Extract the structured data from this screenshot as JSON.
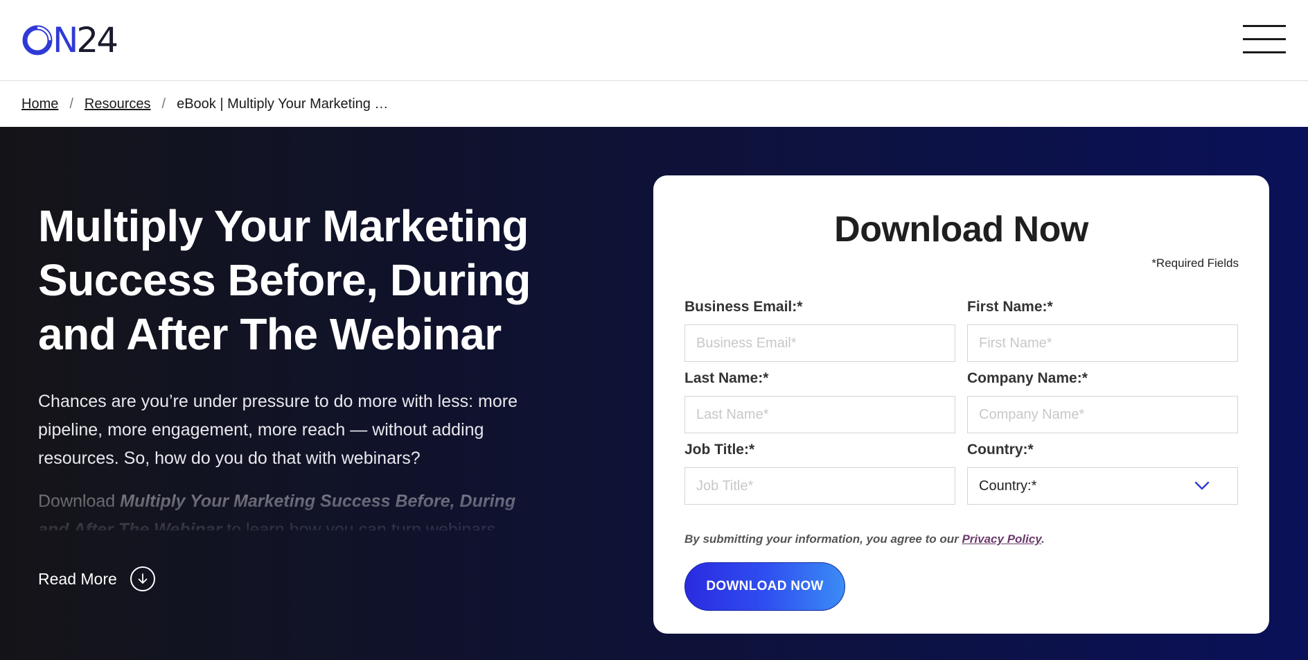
{
  "header": {
    "logo_prefix": "O",
    "logo_n": "N",
    "logo_digits": "24",
    "brand_color": "#2f3ad6"
  },
  "breadcrumb": {
    "items": [
      "Home",
      "Resources"
    ],
    "separator": "/",
    "current": "eBook | Multiply Your Marketing …"
  },
  "hero": {
    "title": "Multiply Your Marketing Success Before, During and After The Webinar",
    "body": "Chances are you’re under pressure to do more with less: more pipeline, more engagement, more reach — without adding resources. So, how do you do that with webinars?",
    "body2_prefix": "Download ",
    "body2_bold": "Multiply Your Marketing Success Before, During and After The Webinar",
    "body2_suffix": " to learn how you can turn webinars",
    "read_more": "Read More"
  },
  "form": {
    "title": "Download Now",
    "required_note": "*Required Fields",
    "fields": [
      {
        "label": "Business Email:*",
        "placeholder": "Business Email*"
      },
      {
        "label": "First Name:*",
        "placeholder": "First Name*"
      },
      {
        "label": "Last Name:*",
        "placeholder": "Last Name*"
      },
      {
        "label": "Company Name:*",
        "placeholder": "Company Name*"
      },
      {
        "label": "Job Title:*",
        "placeholder": "Job Title*"
      }
    ],
    "country": {
      "label": "Country:*",
      "value": "Country:*"
    },
    "consent_text": "By submitting your information, you agree to our ",
    "consent_link": "Privacy Policy",
    "consent_end": ".",
    "submit_label": "DOWNLOAD NOW",
    "accent_color": "#2a2be0"
  }
}
